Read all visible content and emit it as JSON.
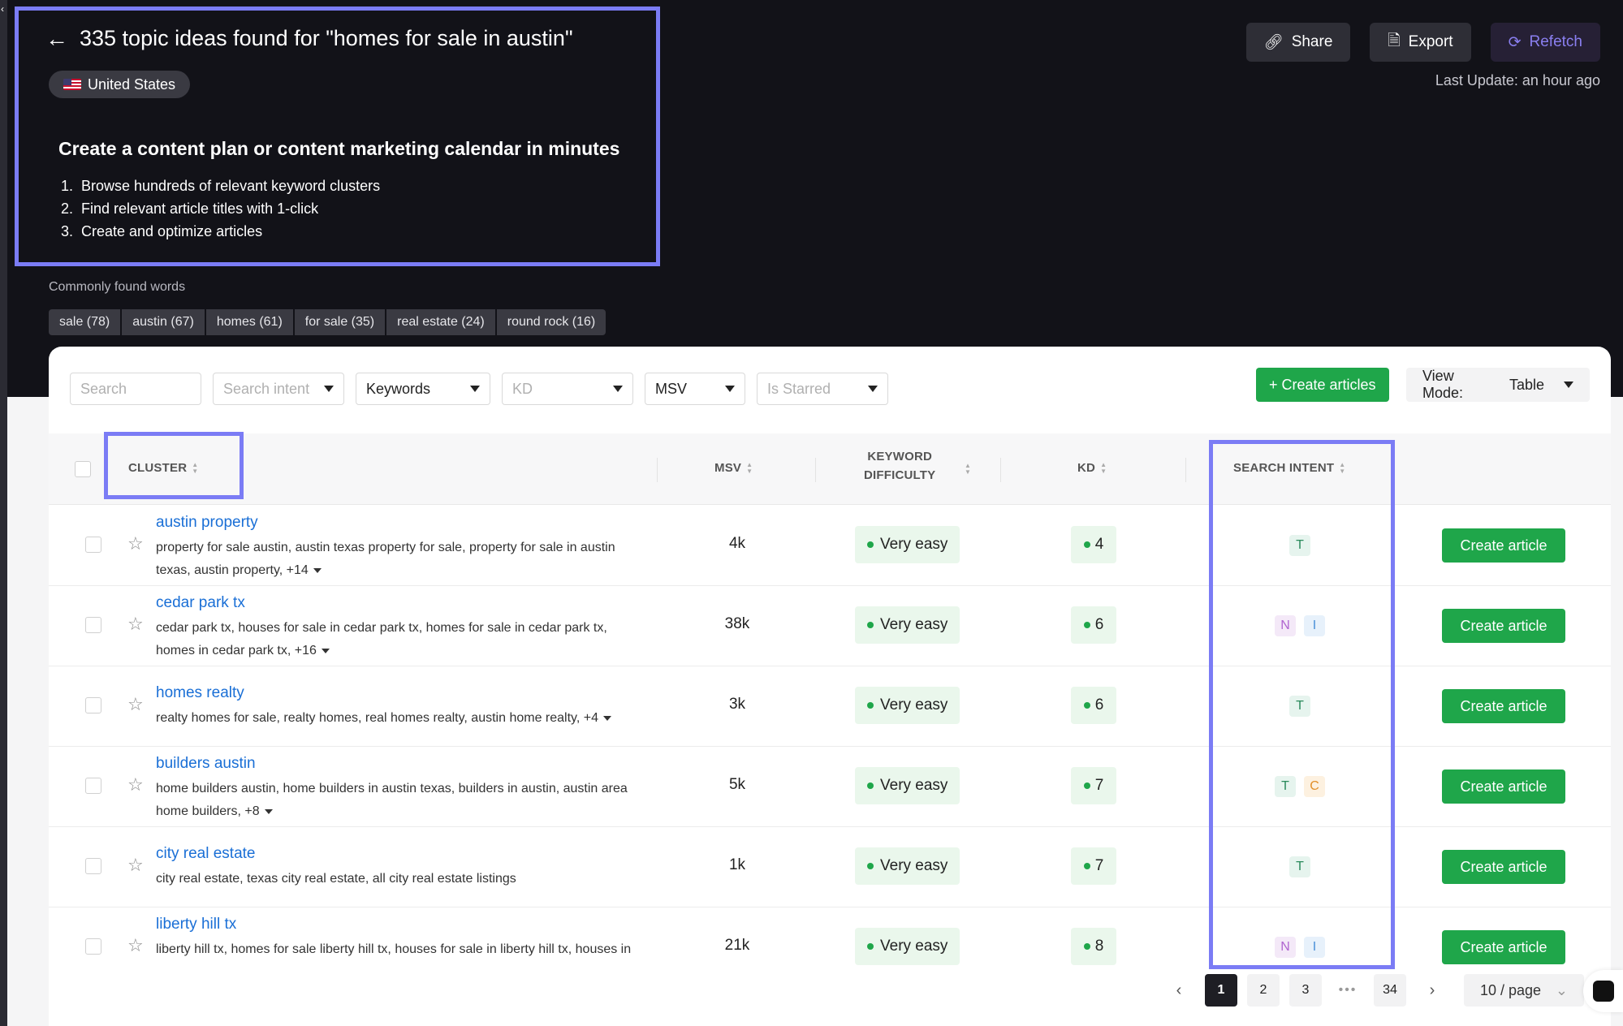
{
  "header": {
    "title": "335 topic ideas found for \"homes for sale in austin\"",
    "country": "United States",
    "promo_heading": "Create a content plan or content marketing calendar in minutes",
    "promo_steps": [
      {
        "num": "1.",
        "text": "Browse hundreds of relevant keyword clusters"
      },
      {
        "num": "2.",
        "text": "Find relevant article titles with 1-click"
      },
      {
        "num": "3.",
        "text": "Create and optimize articles"
      }
    ],
    "share_label": "Share",
    "export_label": "Export",
    "refetch_label": "Refetch",
    "last_update": "Last Update: an hour ago"
  },
  "common_words": {
    "label": "Commonly found words",
    "chips": [
      "sale (78)",
      "austin (67)",
      "homes (61)",
      "for sale (35)",
      "real estate (24)",
      "round rock (16)"
    ]
  },
  "filters": {
    "search_placeholder": "Search",
    "search_intent": "Search intent",
    "keywords": "Keywords",
    "kd": "KD",
    "msv": "MSV",
    "is_starred": "Is Starred",
    "create_articles": "+ Create articles",
    "view_mode_label": "View Mode:",
    "view_mode_value": "Table"
  },
  "table": {
    "headers": {
      "cluster": "CLUSTER",
      "msv": "MSV",
      "keyword_difficulty_1": "KEYWORD",
      "keyword_difficulty_2": "DIFFICULTY",
      "kd": "KD",
      "search_intent": "SEARCH INTENT"
    },
    "rows": [
      {
        "cluster": "austin property",
        "kw1": "property for sale austin, austin texas property for sale, property for sale in austin",
        "kw2": "texas, austin property, +14",
        "msv": "4k",
        "difficulty": "Very easy",
        "kd": "4",
        "intents": [
          "T"
        ],
        "action": "Create article"
      },
      {
        "cluster": "cedar park tx",
        "kw1": "cedar park tx, houses for sale in cedar park tx, homes for sale in cedar park tx,",
        "kw2": "homes in cedar park tx, +16",
        "msv": "38k",
        "difficulty": "Very easy",
        "kd": "6",
        "intents": [
          "N",
          "I"
        ],
        "action": "Create article"
      },
      {
        "cluster": "homes realty",
        "kw1": "realty homes for sale, realty homes, real homes realty, austin home realty, +4",
        "kw2": "",
        "msv": "3k",
        "difficulty": "Very easy",
        "kd": "6",
        "intents": [
          "T"
        ],
        "action": "Create article"
      },
      {
        "cluster": "builders austin",
        "kw1": "home builders austin, home builders in austin texas, builders in austin, austin area",
        "kw2": "home builders, +8",
        "msv": "5k",
        "difficulty": "Very easy",
        "kd": "7",
        "intents": [
          "T",
          "C"
        ],
        "action": "Create article"
      },
      {
        "cluster": "city real estate",
        "kw1": "city real estate, texas city real estate, all city real estate listings",
        "kw2": "",
        "msv": "1k",
        "difficulty": "Very easy",
        "kd": "7",
        "intents": [
          "T"
        ],
        "action": "Create article"
      },
      {
        "cluster": "liberty hill tx",
        "kw1": "liberty hill tx, homes for sale liberty hill tx, houses for sale in liberty hill tx, houses in",
        "kw2": "",
        "msv": "21k",
        "difficulty": "Very easy",
        "kd": "8",
        "intents": [
          "N",
          "I"
        ],
        "action": "Create article"
      }
    ]
  },
  "pagination": {
    "pages": [
      "1",
      "2",
      "3",
      "34"
    ],
    "ellipsis": "•••",
    "page_size": "10 / page"
  },
  "colors": {
    "highlight": "#7b7cf5",
    "primary_green": "#1fa64a",
    "link_blue": "#1a6fd6"
  }
}
